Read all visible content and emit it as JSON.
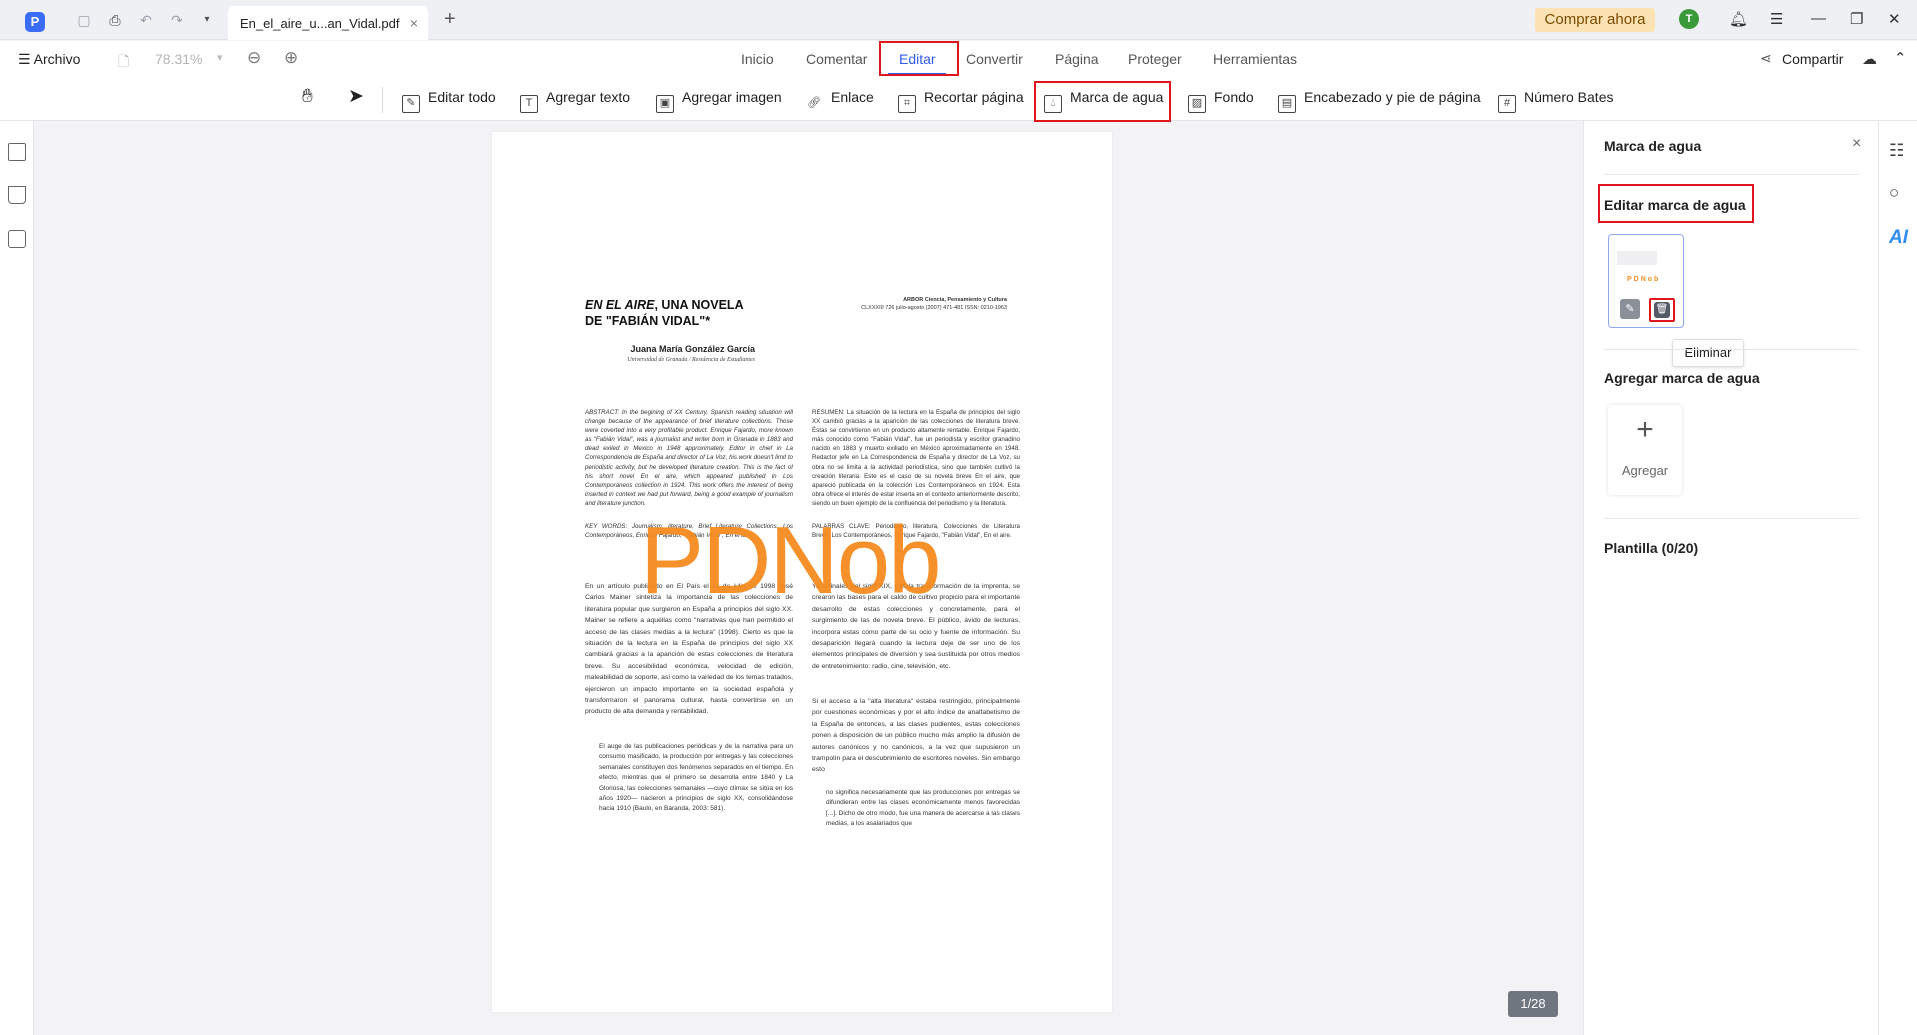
{
  "app": {
    "logo_glyph": "P",
    "tab_title": "En_el_aire_u...an_Vidal.pdf",
    "tab_close": "×",
    "new_tab": "+",
    "buy_button": "Comprar ahora",
    "avatar_initial": "T"
  },
  "menu": {
    "file_label": "Archivo",
    "zoom": "78.31%",
    "tabs": [
      "Inicio",
      "Comentar",
      "Editar",
      "Convertir",
      "Página",
      "Proteger",
      "Herramientas"
    ],
    "active_tab": "Editar",
    "share_label": "Compartir"
  },
  "toolbar": {
    "tools": [
      "Editar todo",
      "Agregar texto",
      "Agregar imagen",
      "Enlace",
      "Recortar página",
      "Marca de agua",
      "Fondo",
      "Encabezado y pie de página",
      "Número Bates"
    ],
    "active_tool": "Marca de agua"
  },
  "document": {
    "title_line1_italic": "EN EL AIRE",
    "title_line1_rest": ", UNA NOVELA",
    "title_line2": "DE \"FABIÁN VIDAL\"*",
    "journal_line1": "ARBOR Ciencia, Pensamiento y Cultura",
    "journal_line2": "CLXXXIII 726 julio-agosto (2007) 471-481 ISSN: 0210-1963",
    "author": "Juana María González García",
    "affiliation": "Universidad de Granada / Residencia de Estudiantes",
    "abstract_en": "ABSTRACT: In the begining of XX Century, Spanish reading situation will change because of the appearance of brief literature collections. Those were coverted into a very profitable product. Enrique Fajardo, more known as \"Fabián Vidal\", was a journalist and writer born in Granada in 1883 and dead exiled in Mexico in 1948 approximately. Editor in chief in La Correspondencia de España and director of La Voz, his work doesn't limit to periodistic activity, but he developed literature creation. This is the fact of his short novel En el aire, which appeared published in Los Contemporáneos collection in 1924. This work offers the interest of being inserted in context we had put forward, being a good example of journalism and literature junction.",
    "keywords_en": "KEY WORDS: Journalism, literature, Brief Literature Collections, Los Contemporáneos, Enrique Fajardo, \"Fabián Vidal\", En el aire.",
    "abstract_es": "RESUMEN: La situación de la lectura en la España de principios del siglo XX cambió gracias a la aparición de las colecciones de literatura breve. Éstas se convirtieron en un producto altamente rentable. Enrique Fajardo, más conocido como \"Fabián Vidal\", fue un periodista y escritor granadino nacido en 1883 y muerto exiliado en México aproximadamente en 1948. Redactor jefe en La Correspondencia de España y director de La Voz, su obra no se limita a la actividad periodística, sino que también cultivó la creación literaria. Este es el caso de su novela breve En el aire, que apareció publicada en la colección Los Contemporáneos en 1924. Esta obra ofrece el interés de estar inserta en el contexto anteriormente descrito, siendo un buen ejemplo de la confluencia del periodismo y la literatura.",
    "keywords_es": "PALABRAS CLAVE: Periodismo, literatura, Colecciones de Literatura Breve, Los Contemporáneos, Enrique Fajardo, \"Fabián Vidal\", En el aire.",
    "body_left": "En un artículo publicado en El País el 11 de julio de 1998 José Carlos Mainer sintetiza la importancia de las colecciones de literatura popular que surgieron en España a principios del siglo XX. Mainer se refiere a aquéllas como \"narrativas que han permitido el acceso de las clases medias a la lectura\" (1998). Cierto es que la situación de la lectura en la España de principios del siglo XX cambiará gracias a la aparición de estas colecciones de literatura breve. Su accesibilidad económica, velocidad de edición, maleabilidad de soporte, así como la variedad de los temas tratados, ejercieron un impacto importante en la sociedad española y transformaron el panorama cultural, hasta convertirse en un producto de alta demanda y rentabilidad.",
    "quote_left": "El auge de las publicaciones periódicas y de la narrativa para un consumo masificado, la producción por entregas y las colecciones semanales constituyen dos fenómenos separados en el tiempo. En efecto, mientras que el primero se desarrolla entre 1840 y La Gloriosa, las colecciones semanales —cuyo climax se sitúa en los años 1920— nacieron a principios de siglo XX, consolidándose hacia 1910 (Baulo, en Baranda, 2003: 581).",
    "body_right": "Ya a finales del siglo XIX, tras la transformación de la imprenta, se crearon las bases para el caldo de cultivo propicio para el importante desarrollo de estas colecciones y concretamente, para el surgimiento de las de novela breve. El público, ávido de lecturas, incorpora estas como parte de su ocio y fuente de información. Su desaparición llegará cuando la lectura deje de ser uno de los elementos principales de diversión y sea sustituida por otros medios de entretenimiento: radio, cine, televisión, etc.",
    "body_right2": "Si el acceso a la \"alta literatura\" estaba restringido, principalmente por cuestiones económicas y por el alto índice de analfabetismo de la España de entonces, a las clases pudientes, estas colecciones ponen a disposición de un público mucho más amplio la difusión de autores canónicos y no canónicos, a la vez que supusieron un trampolín para el descubrimiento de escritores noveles. Sin embargo esto",
    "quote_right": "no significa necesariamente que las producciones por entregas se difundieran entre las clases económicamente menos favorecidas [...]. Dicho de otro modo, fue una manera de acercarse a las clases medias, a los asalariados que",
    "watermark": "PDNob",
    "page_indicator": "1/28"
  },
  "panel": {
    "title": "Marca de agua",
    "close": "×",
    "edit_section": "Editar marca de agua",
    "thumb_watermark": "PDNob",
    "tooltip": "Eliminar",
    "add_section": "Agregar marca de agua",
    "add_plus": "+",
    "add_label": "Agregar",
    "template_section": "Plantilla  (0/20)"
  },
  "right_rail": {
    "ai_label": "AI"
  },
  "colors": {
    "accent": "#2f5bea",
    "highlight": "#e0161e",
    "watermark": "#f58b1f",
    "buy_bg": "#fde3b4"
  }
}
